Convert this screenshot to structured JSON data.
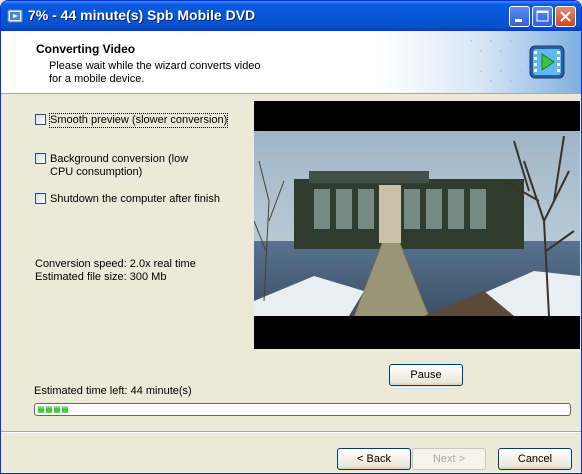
{
  "window": {
    "title": "7% - 44 minute(s)  Spb Mobile DVD"
  },
  "header": {
    "title": "Converting Video",
    "subtitle": "Please wait while the wizard converts video for a mobile device."
  },
  "options": {
    "smooth_preview": {
      "label": "Smooth preview (slower conversion)",
      "checked": false
    },
    "background_conversion": {
      "label_line1": "Background conversion (low",
      "label_line2": "CPU consumption)",
      "checked": false
    },
    "shutdown": {
      "label": "Shutdown the computer after finish",
      "checked": false
    }
  },
  "stats": {
    "speed": "Conversion speed: 2.0x real time",
    "file_size": "Estimated file size: 300 Mb"
  },
  "pause_label": "Pause",
  "time_left": "Estimated time left: 44 minute(s)",
  "progress": {
    "percent": 7
  },
  "buttons": {
    "back": "< Back",
    "next": "Next >",
    "cancel": "Cancel"
  },
  "colors": {
    "titlebar": "#0755d6",
    "progress": "#2ec42e",
    "dialog_bg": "#ece9d8"
  }
}
